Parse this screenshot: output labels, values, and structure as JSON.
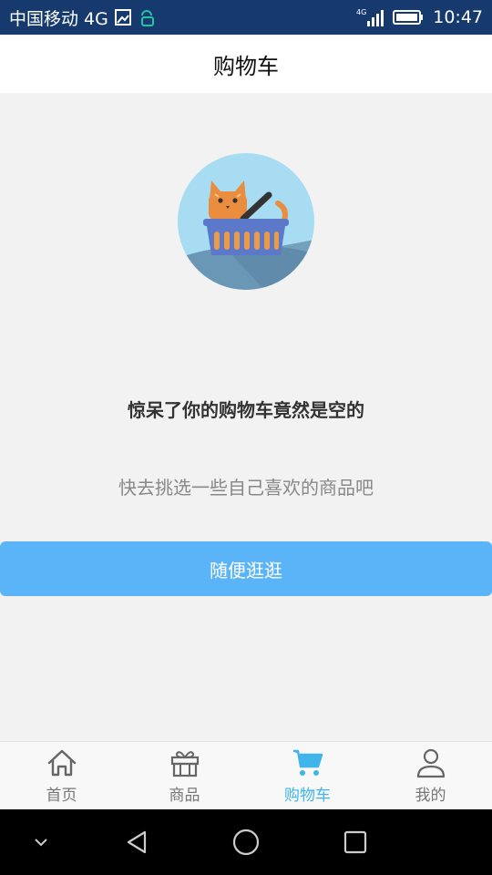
{
  "status_bar": {
    "carrier": "中国移动 4G",
    "network_label": "4G",
    "time": "10:47"
  },
  "header": {
    "title": "购物车"
  },
  "empty_state": {
    "title": "惊呆了你的购物车竟然是空的",
    "subtitle": "快去挑选一些自己喜欢的商品吧",
    "button_label": "随便逛逛"
  },
  "tabbar": {
    "tabs": [
      {
        "label": "首页",
        "icon": "home-icon",
        "active": false
      },
      {
        "label": "商品",
        "icon": "gift-icon",
        "active": false
      },
      {
        "label": "购物车",
        "icon": "cart-icon",
        "active": true
      },
      {
        "label": "我的",
        "icon": "user-icon",
        "active": false
      }
    ]
  },
  "colors": {
    "status_bar_bg": "#163a6e",
    "accent": "#5ab4f7",
    "tab_active": "#3fb5ea",
    "tab_inactive": "#777777"
  }
}
